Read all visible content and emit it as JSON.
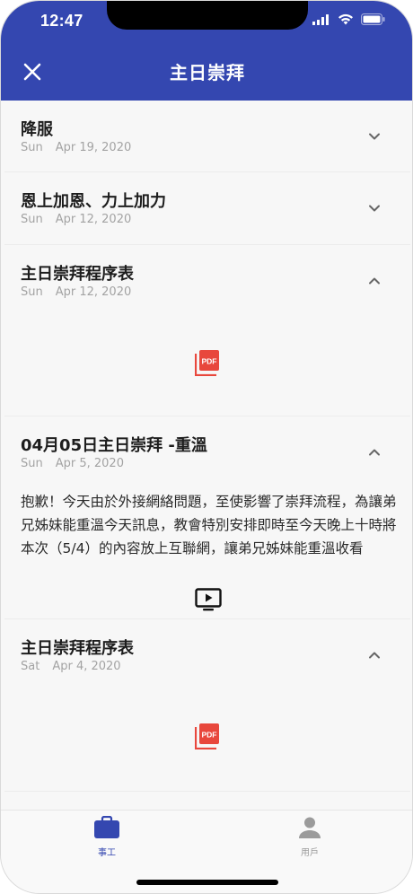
{
  "status": {
    "time": "12:47"
  },
  "appbar": {
    "title": "主日崇拜"
  },
  "items": [
    {
      "title": "降服",
      "weekday": "Sun",
      "date": "Apr 19, 2020"
    },
    {
      "title": "恩上加恩、力上加力",
      "weekday": "Sun",
      "date": "Apr 12, 2020"
    },
    {
      "title": "主日崇拜程序表",
      "weekday": "Sun",
      "date": "Apr 12, 2020",
      "attachment": "PDF"
    },
    {
      "title": "04月05日主日崇拜 -重溫",
      "weekday": "Sun",
      "date": "Apr 5, 2020",
      "body": "抱歉！今天由於外接網絡問題，至使影響了崇拜流程，為讓弟兄姊妹能重溫今天訊息，教會特別安排即時至今天晚上十時將本次（5/4）的內容放上互聯網，讓弟兄姊妹能重溫收看"
    },
    {
      "title": "主日崇拜程序表",
      "weekday": "Sat",
      "date": "Apr 4, 2020",
      "attachment": "PDF"
    }
  ],
  "tabs": [
    {
      "label": "事工"
    },
    {
      "label": "用戶"
    }
  ],
  "colors": {
    "primary": "#3447b0",
    "pdf": "#e8473c"
  }
}
